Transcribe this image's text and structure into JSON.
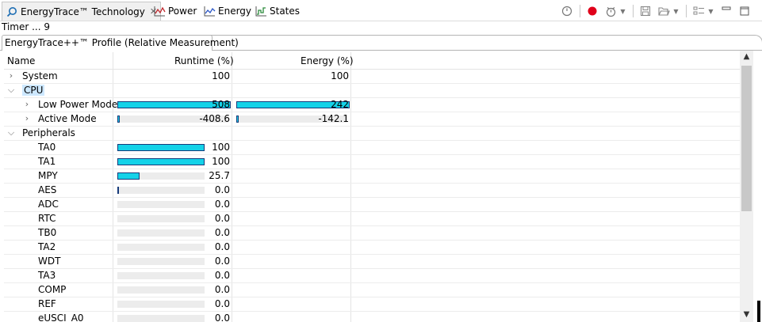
{
  "tabs": [
    {
      "label": "EnergyTrace™ Technology",
      "icon": "energytrace-icon",
      "active": true
    },
    {
      "label": "Power",
      "icon": "power-graph-icon"
    },
    {
      "label": "Energy",
      "icon": "energy-graph-icon"
    },
    {
      "label": "States",
      "icon": "states-graph-icon"
    }
  ],
  "toolbar_icons": [
    "clock-icon",
    "record-icon",
    "timer-icon",
    "chevron-down-icon",
    "save-icon",
    "open-folder-icon",
    "chevron-down-icon",
    "layout-icon",
    "chevron-down-icon",
    "minimize-icon",
    "restore-icon"
  ],
  "timer_text": "Timer ... 9",
  "profile_tab": "EnergyTrace++™ Profile (Relative Measurement)",
  "columns": {
    "name": "Name",
    "runtime": "Runtime (%)",
    "energy": "Energy (%)"
  },
  "rows": [
    {
      "name": "System",
      "level": 0,
      "expander": "collapsed",
      "runtime": "100",
      "energy": "100"
    },
    {
      "name": "CPU",
      "level": 0,
      "expander": "expanded",
      "selected": true,
      "runtime": "",
      "energy": ""
    },
    {
      "name": "Low Power Mode",
      "level": 1,
      "expander": "collapsed",
      "runtime": "508",
      "energy": "242",
      "runtime_bar": 1.0,
      "energy_bar": 1.0
    },
    {
      "name": "Active Mode",
      "level": 1,
      "expander": "collapsed",
      "runtime": "-408.6",
      "energy": "-142.1",
      "runtime_bar": 0.03,
      "energy_bar": 0.03
    },
    {
      "name": "Peripherals",
      "level": 0,
      "expander": "expanded",
      "runtime": "",
      "energy": ""
    },
    {
      "name": "TA0",
      "level": 1,
      "runtime": "100",
      "runtime_bar": 1.0
    },
    {
      "name": "TA1",
      "level": 1,
      "runtime": "100",
      "runtime_bar": 1.0
    },
    {
      "name": "MPY",
      "level": 1,
      "runtime": "25.7",
      "runtime_bar": 0.257
    },
    {
      "name": "AES",
      "level": 1,
      "runtime": "0.0",
      "runtime_bar": 0.01
    },
    {
      "name": "ADC",
      "level": 1,
      "runtime": "0.0",
      "runtime_bar": 0
    },
    {
      "name": "RTC",
      "level": 1,
      "runtime": "0.0",
      "runtime_bar": 0
    },
    {
      "name": "TB0",
      "level": 1,
      "runtime": "0.0",
      "runtime_bar": 0
    },
    {
      "name": "TA2",
      "level": 1,
      "runtime": "0.0",
      "runtime_bar": 0
    },
    {
      "name": "WDT",
      "level": 1,
      "runtime": "0.0",
      "runtime_bar": 0
    },
    {
      "name": "TA3",
      "level": 1,
      "runtime": "0.0",
      "runtime_bar": 0
    },
    {
      "name": "COMP",
      "level": 1,
      "runtime": "0.0",
      "runtime_bar": 0
    },
    {
      "name": "REF",
      "level": 1,
      "runtime": "0.0",
      "runtime_bar": 0
    },
    {
      "name": "eUSCI_A0",
      "level": 1,
      "runtime": "0.0",
      "runtime_bar": 0
    }
  ],
  "colors": {
    "bar_fill": "#14d2e8",
    "bar_border": "#163a7a",
    "track": "#ececec",
    "selection": "#cde8ff",
    "record": "#e0001a"
  }
}
